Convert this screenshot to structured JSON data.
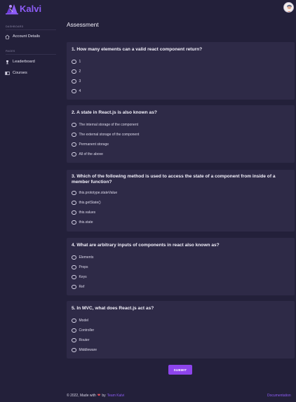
{
  "brand": {
    "name": "Kalvi"
  },
  "sidebar": {
    "sections": [
      {
        "label": "DASHBOARD",
        "items": [
          {
            "label": "Account Details",
            "icon": "home-icon"
          }
        ]
      },
      {
        "label": "PAGES",
        "items": [
          {
            "label": "Leaderboard",
            "icon": "trophy-icon"
          },
          {
            "label": "Courses",
            "icon": "book-icon"
          }
        ]
      }
    ]
  },
  "main": {
    "title": "Assessment"
  },
  "questions": [
    {
      "text": "1. How many elements can a valid react component return?",
      "options": [
        "1",
        "2",
        "3",
        "4"
      ]
    },
    {
      "text": "2. A state in React.js is also known as?",
      "options": [
        "The internal storage of the component",
        "The external storage of the component",
        "Permanent storage",
        "All of the above"
      ]
    },
    {
      "text": "3. Which of the following method is used to access the state of a component from inside of a member function?",
      "options": [
        "this.prototype.stateValue",
        "this.getState()",
        "this.values",
        "this.state"
      ]
    },
    {
      "text": "4. What are arbitrary inputs of components in react also known as?",
      "options": [
        "Elements",
        "Props",
        "Keys",
        "Ref"
      ]
    },
    {
      "text": "5. In MVC, what does React.js act as?",
      "options": [
        "Model",
        "Controller",
        "Router",
        "Middleware"
      ]
    }
  ],
  "submit_label": "SUBMIT",
  "footer": {
    "copyright": "© 2022, Made with",
    "by": "by",
    "team": "Team Kalvi",
    "documentation": "Documentation"
  },
  "colors": {
    "accent": "#8d5cf6",
    "button": "#8d44ec",
    "background": "#23203a",
    "card": "#2e2a47",
    "heart": "#e8505b"
  }
}
